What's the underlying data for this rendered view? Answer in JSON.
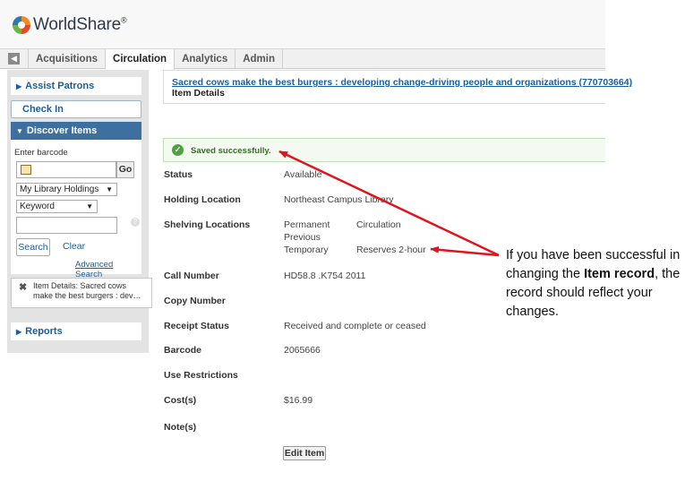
{
  "app": {
    "name": "WorldShare",
    "trademark": "®"
  },
  "tabs": [
    {
      "label": "Acquisitions",
      "active": false
    },
    {
      "label": "Circulation",
      "active": true
    },
    {
      "label": "Analytics",
      "active": false
    },
    {
      "label": "Admin",
      "active": false
    }
  ],
  "sidebar": {
    "assist_patrons": "Assist Patrons",
    "check_in": "Check In",
    "discover_items": "Discover Items",
    "enter_barcode_label": "Enter barcode",
    "go_label": "Go",
    "holdings_select": "My Library Holdings",
    "search_type_select": "Keyword",
    "keyword_value": "",
    "help_mark": "?",
    "search_label": "Search",
    "clear_label": "Clear",
    "advanced_search": "Advanced Search",
    "recent_item": "Item Details: Sacred cows make the best burgers : dev…",
    "reports": "Reports"
  },
  "main": {
    "title": "Sacred cows make the best burgers : developing change-driving people and organizations (770703664)",
    "subtitle": "Item Details",
    "saved_message": "Saved successfully.",
    "fields": {
      "status": {
        "label": "Status",
        "value": "Available"
      },
      "holding_location": {
        "label": "Holding Location",
        "value": "Northeast Campus Library"
      },
      "shelving": {
        "label": "Shelving Locations",
        "permanent_label": "Permanent",
        "permanent_value": "Circulation",
        "previous_label": "Previous",
        "previous_value": "",
        "temporary_label": "Temporary",
        "temporary_value": "Reserves 2-hour"
      },
      "call_number": {
        "label": "Call Number",
        "value": "HD58.8 .K754 2011"
      },
      "copy_number": {
        "label": "Copy Number",
        "value": ""
      },
      "receipt_status": {
        "label": "Receipt Status",
        "value": "Received and complete or ceased"
      },
      "barcode": {
        "label": "Barcode",
        "value": "2065666"
      },
      "use_restrictions": {
        "label": "Use Restrictions",
        "value": ""
      },
      "cost": {
        "label": "Cost(s)",
        "value": "$16.99"
      },
      "notes": {
        "label": "Note(s)",
        "value": ""
      }
    },
    "edit_item": "Edit Item"
  },
  "callout": {
    "text_before": "If you have been successful in changing the ",
    "text_bold": "Item record",
    "text_after": ", the record should reflect your changes."
  },
  "colors": {
    "arrow": "#e0141e",
    "link": "#1a5d9c",
    "panel_header": "#3d6f9f",
    "success": "#4fa23f"
  },
  "icons": [
    "worldshare-logo-icon",
    "collapse-left-icon",
    "triangle-right-icon",
    "triangle-down-icon",
    "book-icon",
    "close-icon",
    "checkmark-icon",
    "help-icon"
  ]
}
